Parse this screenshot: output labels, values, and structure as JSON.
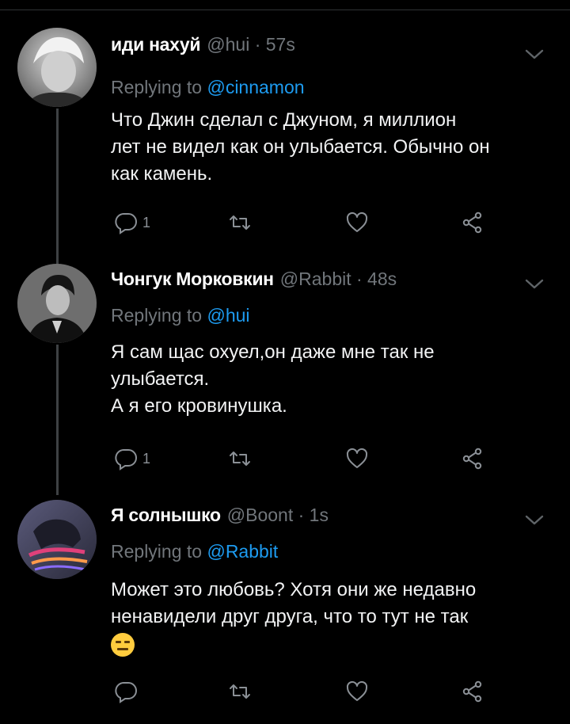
{
  "tweets": [
    {
      "name": "иди нахуй",
      "meta": "@hui · 57s",
      "reply_prefix": "Replying to ",
      "reply_handle": "@cinnamon",
      "lines": [
        "Что Джин сделал с Джуном, я миллион",
        "лет не видел как он улыбается. Обычно он",
        "как камень."
      ],
      "reply_count": "1",
      "has_thread_line": true
    },
    {
      "name": "Чонгук Морковкин",
      "meta": "@Rabbit · 48s",
      "reply_prefix": "Replying to ",
      "reply_handle": "@hui",
      "lines": [
        "Я сам щас охуел,он даже мне так не",
        "улыбается.",
        "А я его кровинушка."
      ],
      "reply_count": "1",
      "has_thread_line": true
    },
    {
      "name": "Я солнышко",
      "meta": "@Boont · 1s",
      "reply_prefix": "Replying to ",
      "reply_handle": "@Rabbit",
      "lines": [
        "Может это любовь? Хотя они же недавно",
        "ненавидели друг друга, что то тут не так"
      ],
      "emoji": "expressionless-face",
      "reply_count": "",
      "has_thread_line": false
    }
  ],
  "icons": {
    "reply": "reply-icon",
    "retweet": "retweet-icon",
    "like": "heart-icon",
    "share": "share-icon",
    "more": "chevron-down-icon"
  },
  "colors": {
    "background": "#000000",
    "link": "#1d9bf0",
    "muted": "#71767b",
    "text": "#f2f3f4"
  }
}
